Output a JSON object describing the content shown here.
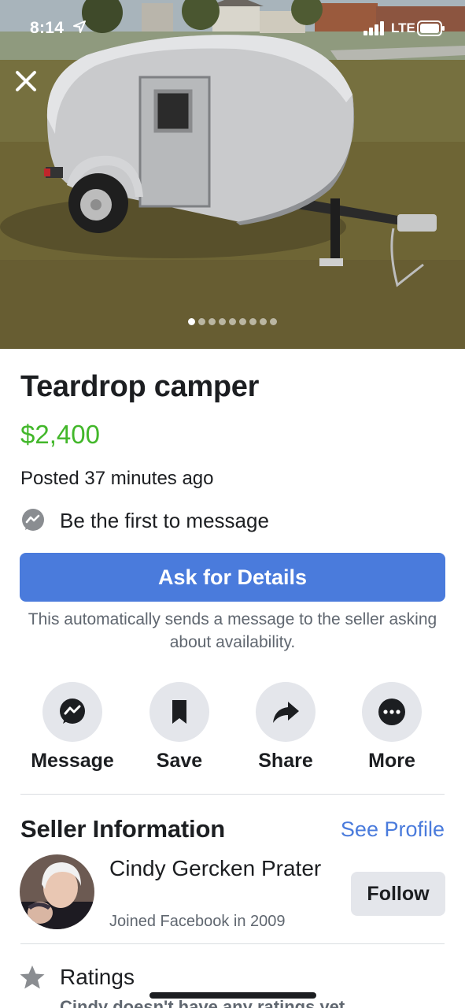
{
  "status_bar": {
    "time": "8:14",
    "network": "LTE"
  },
  "photo": {
    "dots_total": 9,
    "active_dot": 0
  },
  "listing": {
    "title": "Teardrop camper",
    "price": "$2,400",
    "posted": "Posted 37 minutes ago",
    "first_message": "Be the first to message",
    "ask_button": "Ask for Details",
    "ask_note": "This automatically sends a message to the seller asking about availability."
  },
  "actions": {
    "message": "Message",
    "save": "Save",
    "share": "Share",
    "more": "More"
  },
  "seller": {
    "heading": "Seller Information",
    "see_profile": "See Profile",
    "name": "Cindy Gercken Prater",
    "joined": "Joined Facebook in 2009",
    "follow": "Follow"
  },
  "ratings": {
    "label": "Ratings",
    "note": "Cindy doesn't have any ratings yet."
  },
  "colors": {
    "price": "#42b72a",
    "accent": "#4a7bdc",
    "button_grey": "#e4e6eb",
    "secondary_text": "#606770"
  },
  "icons": [
    "location-arrow-icon",
    "signal-icon",
    "battery-icon",
    "close-icon",
    "messenger-icon",
    "bookmark-icon",
    "share-arrow-icon",
    "more-dots-icon",
    "star-icon"
  ]
}
